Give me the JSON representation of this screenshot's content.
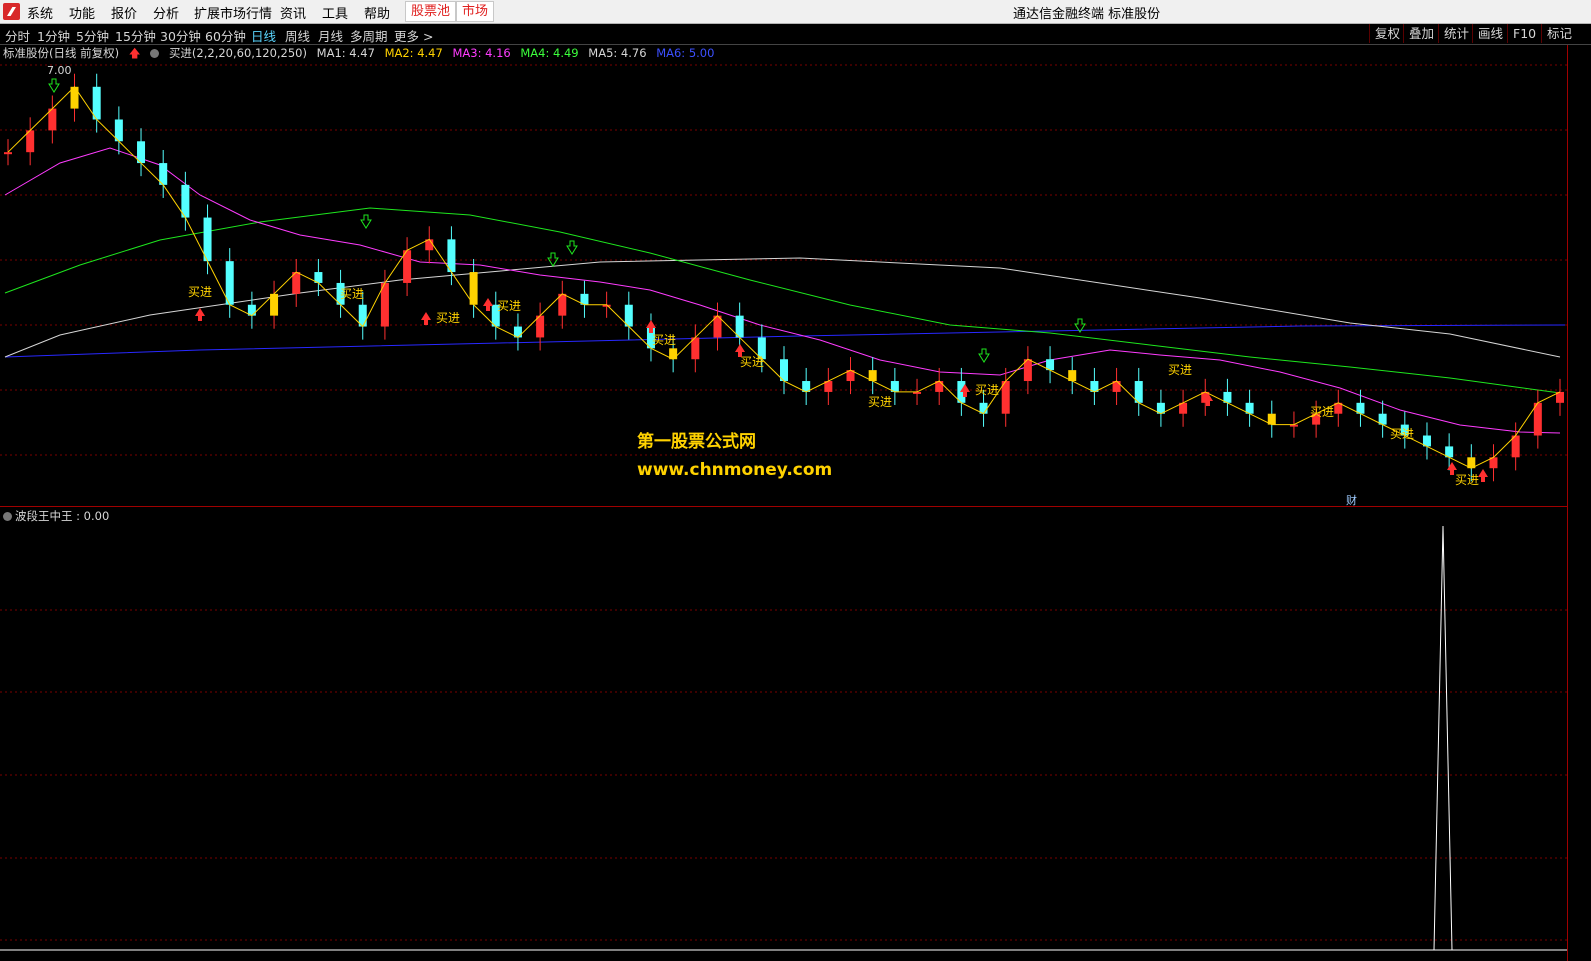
{
  "menubar": {
    "items": [
      "系统",
      "功能",
      "报价",
      "分析",
      "扩展市场行情",
      "资讯",
      "工具",
      "帮助"
    ],
    "pill_stockpool": "股票池",
    "pill_market": "市场",
    "app_title": "通达信金融终端 标准股份"
  },
  "periods": {
    "items": [
      "分时",
      "1分钟",
      "5分钟",
      "15分钟",
      "30分钟",
      "60分钟",
      "日线",
      "周线",
      "月线",
      "多周期",
      "更多 >"
    ],
    "active": "日线"
  },
  "tools": [
    "复权",
    "叠加",
    "统计",
    "画线",
    "F10",
    "标记"
  ],
  "info": {
    "stock": "标准股份(日线 前复权)",
    "formula": "买进(2,2,20,60,120,250)",
    "ma": [
      {
        "label": "MA1: 4.47",
        "color": "#d6d6d6"
      },
      {
        "label": "MA2: 4.47",
        "color": "#ffd200"
      },
      {
        "label": "MA3: 4.16",
        "color": "#ff3cff"
      },
      {
        "label": "MA4: 4.49",
        "color": "#3cff3c"
      },
      {
        "label": "MA5: 4.76",
        "color": "#d6d6d6"
      },
      {
        "label": "MA6: 5.00",
        "color": "#3c50ff"
      }
    ]
  },
  "peak_label": "7.00",
  "buy_label": "买进",
  "sub_indicator": "波段王中王 : 0.00",
  "watermark": {
    "line1": "第一股票公式网",
    "line2": "www.chnmoney.com"
  },
  "cai_label": "财",
  "colors": {
    "up": "#ff3030",
    "down": "#54ffff",
    "yellow": "#ffd200",
    "ma_white": "#d6d6d6",
    "ma_magenta": "#ff3cff",
    "ma_green": "#1ee61e",
    "ma_blue": "#2828ff",
    "grid": "#7a0000"
  },
  "chart_data": {
    "type": "line",
    "title": "",
    "series": [
      {
        "name": "MA3",
        "values": [
          4.16
        ]
      },
      {
        "name": "MA4",
        "values": [
          4.49
        ]
      },
      {
        "name": "MA6",
        "values": [
          5.0
        ]
      }
    ],
    "candles_close_trend": [
      6.4,
      6.6,
      6.8,
      7.0,
      6.7,
      6.5,
      6.3,
      6.1,
      5.8,
      5.4,
      5.0,
      4.9,
      5.1,
      5.3,
      5.2,
      5.0,
      4.8,
      5.2,
      5.5,
      5.6,
      5.3,
      5.0,
      4.8,
      4.7,
      4.9,
      5.1,
      5.0,
      5.0,
      4.8,
      4.6,
      4.5,
      4.7,
      4.9,
      4.7,
      4.5,
      4.3,
      4.2,
      4.3,
      4.4,
      4.3,
      4.2,
      4.2,
      4.3,
      4.1,
      4.0,
      4.3,
      4.5,
      4.4,
      4.3,
      4.2,
      4.3,
      4.1,
      4.0,
      4.1,
      4.2,
      4.1,
      4.0,
      3.9,
      3.9,
      4.0,
      4.1,
      4.0,
      3.9,
      3.8,
      3.7,
      3.6,
      3.5,
      3.6,
      3.8,
      4.1,
      4.2
    ]
  }
}
